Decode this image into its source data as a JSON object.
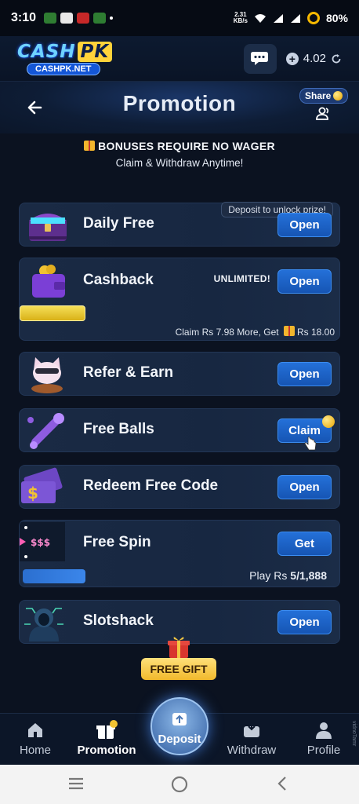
{
  "status_bar": {
    "time": "3:10",
    "speed_value": "2.31",
    "speed_unit": "KB/s",
    "battery": "80%"
  },
  "header": {
    "logo_text": "CASH",
    "logo_badge": "PK",
    "logo_sub": "CASHPK.NET",
    "balance": "4.02"
  },
  "title_bar": {
    "title": "Promotion",
    "share_label": "Share"
  },
  "bonus": {
    "line1": "BONUSES REQUIRE NO WAGER",
    "line2": "Claim & Withdraw Anytime!"
  },
  "promotions": [
    {
      "title": "Daily Free",
      "button": "Open",
      "hint": "Deposit to unlock prize!"
    },
    {
      "title": "Cashback",
      "button": "Open",
      "tag": "UNLIMITED!",
      "note_prefix": "Claim Rs 7.98 More, Get",
      "note_amount": "Rs 18.00",
      "progress": 0.2
    },
    {
      "title": "Refer & Earn",
      "button": "Open"
    },
    {
      "title": "Free Balls",
      "button": "Claim"
    },
    {
      "title": "Redeem Free Code",
      "button": "Open",
      "icon_text": "$"
    },
    {
      "title": "Free Spin",
      "button": "Get",
      "icon_text": "$$$",
      "play_prefix": "Play Rs",
      "play_value": "5/1,888",
      "progress": 0.2
    },
    {
      "title": "Slotshack",
      "button": "Open"
    }
  ],
  "free_gift_label": "FREE GIFT",
  "nav": {
    "home": "Home",
    "promotion": "Promotion",
    "deposit": "Deposit",
    "withdraw": "Withdraw",
    "profile": "Profile"
  },
  "watermark": "vidnoTamr",
  "colors": {
    "accent": "#1d62c8",
    "gold": "#f1c232",
    "background": "#0b1220"
  }
}
